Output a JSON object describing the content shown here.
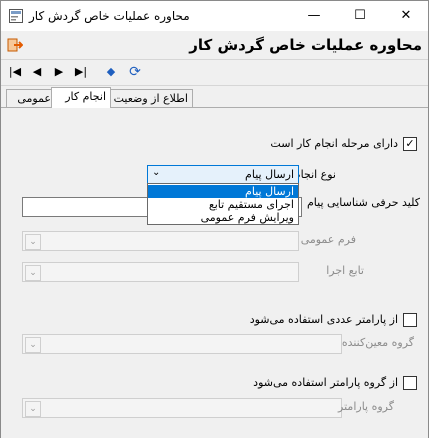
{
  "window": {
    "title": "محاوره عملیات خاص گردش کار",
    "buttons": {
      "minimize": "—",
      "maximize": "☐",
      "close": "✕"
    }
  },
  "header": {
    "title": "محاوره عملیات خاص گردش کار"
  },
  "toolbar": {
    "icons": [
      "first-icon",
      "prev-icon",
      "next-icon",
      "last-icon",
      "erase-icon",
      "refresh-icon"
    ],
    "glyphs": {
      "first": "|◀",
      "prev": "◀",
      "next": "▶",
      "last": "▶|",
      "erase": "◆",
      "refresh": "⟳"
    }
  },
  "tabs": [
    {
      "label": "عمومی",
      "active": false
    },
    {
      "label": "انجام کار",
      "active": true
    },
    {
      "label": "اطلاع از وضعیت",
      "active": false
    }
  ],
  "form": {
    "has_action_stage": {
      "label": "دارای مرحله انجام کار است",
      "checked": true,
      "mark": "✓"
    },
    "action_type": {
      "label": "نوع انجام کار",
      "value": "ارسال پیام",
      "arrow": "⌄"
    },
    "message_key": {
      "label": "کلید حرفی شناسایی پیام"
    },
    "general_form": {
      "label": "فرم عمومی",
      "arrow": "⌄"
    },
    "executor": {
      "label": "تابع اجرا",
      "arrow": "⌄"
    },
    "numeric_param": {
      "label": "از پارامتر عددی استفاده می‌شود",
      "checked": false
    },
    "designated_group": {
      "label": "گروه معین‌کننده",
      "arrow": "⌄"
    },
    "param_group_flag": {
      "label": "از گروه پارامتر استفاده می‌شود",
      "checked": false
    },
    "param_group": {
      "label": "گروه پارامتر",
      "arrow": "⌄"
    }
  },
  "dropdown_options": [
    "ارسال پیام",
    "اجرای مستقیم تابع",
    "ویرایش فرم عمومی"
  ],
  "colors": {
    "selection": "#0078d7",
    "window_bg": "#f0f0f0",
    "accent_icon": "#e35b00",
    "icon_blue": "#1f5fbf"
  }
}
